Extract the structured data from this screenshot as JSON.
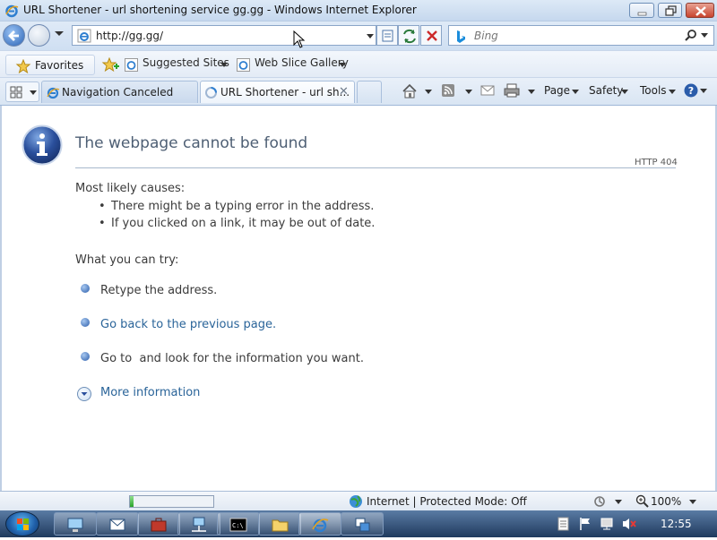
{
  "window": {
    "title": "URL Shortener - url shortening service gg.gg - Windows Internet Explorer"
  },
  "navigation": {
    "address_value": "http://gg.gg/",
    "search_placeholder": "Bing"
  },
  "favorites_bar": {
    "favorites_label": "Favorites",
    "links": [
      "Suggested Sites",
      "Web Slice Gallery"
    ]
  },
  "tabs": [
    {
      "label": "Navigation Canceled"
    },
    {
      "label": "URL Shortener - url sh..."
    }
  ],
  "command_bar": {
    "page_label": "Page",
    "safety_label": "Safety",
    "tools_label": "Tools"
  },
  "error_page": {
    "title": "The webpage cannot be found",
    "http_code": "HTTP 404",
    "causes_heading": "Most likely causes:",
    "causes": [
      "There might be a typing error in the address.",
      "If you clicked on a link, it may be out of date."
    ],
    "try_heading": "What you can try:",
    "retype_text": "Retype the address.",
    "go_back_link": "Go back to the previous page.",
    "goto_text": "Go to  and look for the information you want.",
    "more_info_link": "More information"
  },
  "status_bar": {
    "progress": 0.04,
    "zone": "Internet | Protected Mode: Off",
    "zoom": "100%"
  },
  "taskbar": {
    "clock": "12:55"
  },
  "colors": {
    "link": "#2a6499",
    "title_text": "#4e5f74",
    "progress_fill": "#2aa32a"
  }
}
